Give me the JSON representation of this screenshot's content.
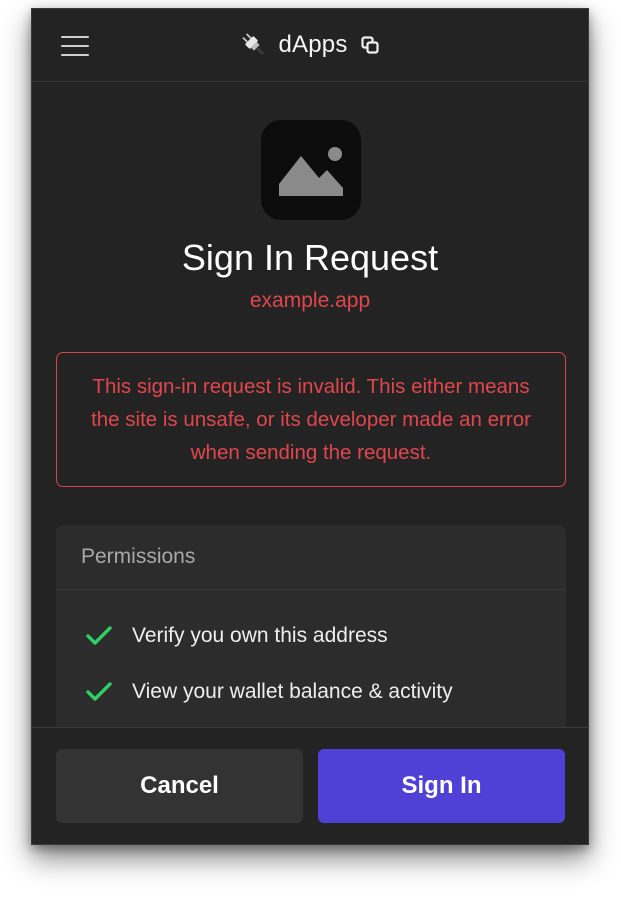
{
  "header": {
    "title": "dApps",
    "menu_icon": "hamburger-menu-icon",
    "logo_icon": "plug-icon",
    "copy_icon": "copy-icon"
  },
  "request": {
    "app_icon": "image-placeholder-icon",
    "title": "Sign In Request",
    "domain": "example.app",
    "error_message": "This sign-in request is invalid. This either means the site is unsafe, or its developer made an error when sending the request."
  },
  "permissions": {
    "heading": "Permissions",
    "items": [
      {
        "label": "Verify you own this address",
        "icon": "check-icon"
      },
      {
        "label": "View your wallet balance & activity",
        "icon": "check-icon"
      }
    ]
  },
  "actions": {
    "cancel_label": "Cancel",
    "sign_in_label": "Sign In"
  },
  "colors": {
    "background": "#232323",
    "error": "#e0464d",
    "accent": "#4f40d6",
    "check": "#2fcf63"
  }
}
